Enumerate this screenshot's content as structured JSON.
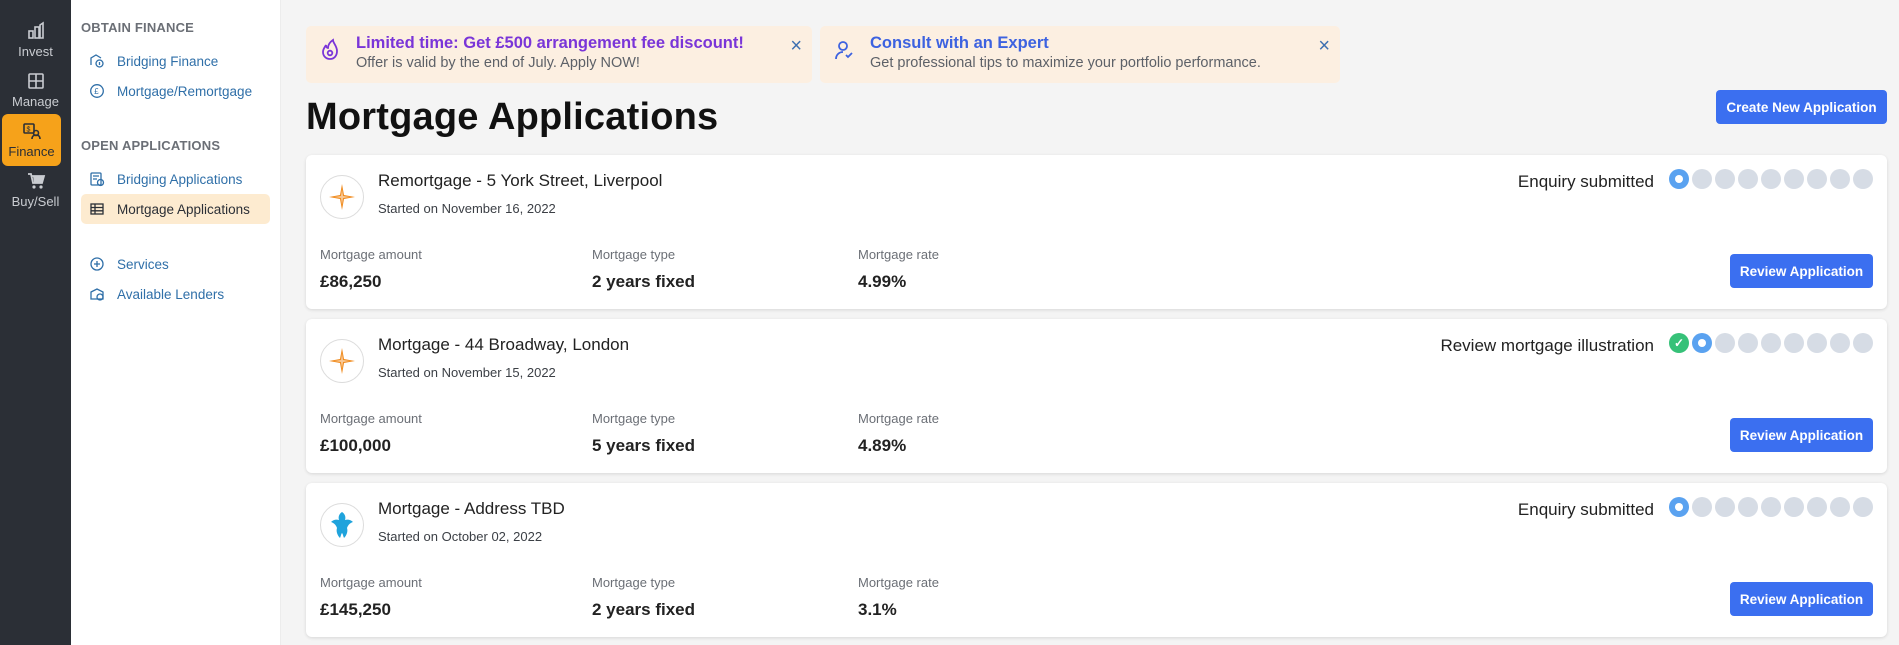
{
  "rail": [
    {
      "label": "Invest",
      "icon": "invest-icon"
    },
    {
      "label": "Manage",
      "icon": "manage-icon"
    },
    {
      "label": "Finance",
      "icon": "finance-icon",
      "active": true
    },
    {
      "label": "Buy/Sell",
      "icon": "cart-icon"
    }
  ],
  "subnav": {
    "obtain_title": "OBTAIN FINANCE",
    "obtain_items": [
      {
        "label": "Bridging Finance",
        "icon": "bridging-finance-icon"
      },
      {
        "label": "Mortgage/Remortgage",
        "icon": "pound-coin-icon"
      }
    ],
    "open_title": "OPEN APPLICATIONS",
    "open_items": [
      {
        "label": "Bridging Applications",
        "icon": "bridging-applications-icon"
      },
      {
        "label": "Mortgage Applications",
        "icon": "table-icon",
        "active": true
      }
    ],
    "other_items": [
      {
        "label": "Services",
        "icon": "services-icon"
      },
      {
        "label": "Available Lenders",
        "icon": "lenders-icon"
      }
    ]
  },
  "promos": [
    {
      "title": "Limited time: Get £500 arrangement fee discount!",
      "subtitle": "Offer is valid by the end of July. Apply NOW!",
      "title_color": "#7a35d8",
      "icon": "fire-icon"
    },
    {
      "title": "Consult with an Expert",
      "subtitle": "Get professional tips to maximize your portfolio performance.",
      "title_color": "#3d62e0",
      "icon": "expert-icon"
    }
  ],
  "page": {
    "title": "Mortgage Applications",
    "create_label": "Create New Application",
    "close_symbol": "×"
  },
  "labels": {
    "amount": "Mortgage amount",
    "type": "Mortgage type",
    "rate": "Mortgage rate",
    "review": "Review Application"
  },
  "applications": [
    {
      "title": "Remortgage - 5 York Street, Liverpool",
      "started": "Started on November 16, 2022",
      "status": "Enquiry submitted",
      "amount": "£86,250",
      "type": "2 years fixed",
      "rate": "4.99%",
      "lender_icon": "star-lender-logo",
      "steps_done": 0,
      "steps_total": 9
    },
    {
      "title": "Mortgage - 44 Broadway, London",
      "started": "Started on November 15, 2022",
      "status": "Review mortgage illustration",
      "amount": "£100,000",
      "type": "5 years fixed",
      "rate": "4.89%",
      "lender_icon": "star-lender-logo",
      "steps_done": 1,
      "steps_total": 9
    },
    {
      "title": "Mortgage - Address TBD",
      "started": "Started on October 02, 2022",
      "status": "Enquiry submitted",
      "amount": "£145,250",
      "type": "2 years fixed",
      "rate": "3.1%",
      "lender_icon": "eagle-lender-logo",
      "steps_done": 0,
      "steps_total": 9
    }
  ],
  "colors": {
    "accent": "#3b6ff0",
    "rail_active": "#f6a21a",
    "step_current": "#5aa2f0",
    "step_done": "#36c178",
    "step_pending": "#d6dce5"
  }
}
